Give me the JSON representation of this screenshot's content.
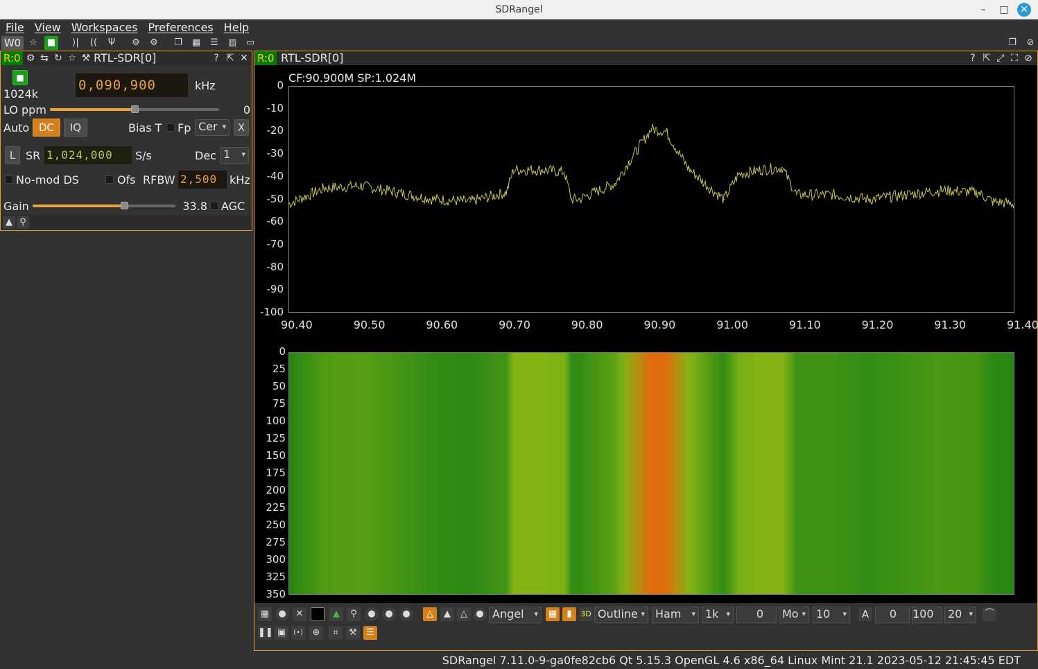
{
  "window": {
    "title": "SDRangel"
  },
  "menu": [
    "File",
    "View",
    "Workspaces",
    "Preferences",
    "Help"
  ],
  "workspace_label": "W0",
  "device_panel": {
    "rtag": "R:0",
    "title": "RTL-SDR[0]",
    "sample_rate_label": "1024k",
    "frequency": "0,090,900",
    "freq_unit": "kHz",
    "lo_ppm_label": "LO ppm",
    "lo_ppm_value": "0",
    "lo_ppm_fraction": 0.5,
    "auto_label": "Auto",
    "dc_label": "DC",
    "iq_label": "IQ",
    "bias_t_label": "Bias T",
    "fp_label": "Fp",
    "fp_combo": "Cer",
    "x_label": "X",
    "l_label": "L",
    "sr_label": "SR",
    "sr_value": "1,024,000",
    "sr_unit": "S/s",
    "dec_label": "Dec",
    "dec_value": "1",
    "nomod_label": "No-mod DS",
    "ofs_label": "Ofs",
    "rfbw_label": "RFBW",
    "rfbw_value": "2,500",
    "rfbw_unit": "kHz",
    "gain_label": "Gain",
    "gain_value": "33.8",
    "gain_fraction": 0.64,
    "agc_label": "AGC"
  },
  "spectrum_panel": {
    "rtag": "R:0",
    "title": "RTL-SDR[0]",
    "info": "CF:90.900M SP:1.024M",
    "y_ticks": [
      "0",
      "-10",
      "-20",
      "-30",
      "-40",
      "-50",
      "-60",
      "-70",
      "-80",
      "-90",
      "-100"
    ],
    "x_ticks": [
      "90.40",
      "90.50",
      "90.60",
      "90.70",
      "90.80",
      "90.90",
      "91.00",
      "91.10",
      "91.20",
      "91.30",
      "91.40"
    ],
    "wf_ticks": [
      "0",
      "25",
      "50",
      "75",
      "100",
      "125",
      "150",
      "175",
      "200",
      "225",
      "250",
      "275",
      "300",
      "325",
      "350"
    ],
    "trace_color": "#c8c85a",
    "bottom_controls": {
      "palette": "Angel",
      "fill": "Outline",
      "window": "Ham",
      "fft_size": "1k",
      "overlap": "0",
      "mode": "Mo",
      "rate": "10",
      "avg_label": "A",
      "ref": "0",
      "range": "100",
      "fps": "20"
    }
  },
  "chart_data": {
    "type": "line",
    "title": "CF:90.900M SP:1.024M",
    "xlim": [
      90.4,
      91.4
    ],
    "ylim": [
      -100,
      0
    ],
    "x": [
      90.4,
      90.45,
      90.5,
      90.55,
      90.6,
      90.65,
      90.7,
      90.71,
      90.75,
      90.78,
      90.79,
      90.8,
      90.85,
      90.87,
      90.9,
      90.92,
      90.95,
      90.98,
      91.0,
      91.02,
      91.05,
      91.08,
      91.1,
      91.15,
      91.2,
      91.25,
      91.3,
      91.35,
      91.37,
      91.4
    ],
    "y": [
      -52,
      -45,
      -44,
      -47,
      -50,
      -51,
      -47,
      -37,
      -37,
      -38,
      -50,
      -50,
      -43,
      -33,
      -19,
      -20,
      -36,
      -45,
      -50,
      -39,
      -37,
      -36,
      -48,
      -48,
      -50,
      -48,
      -46,
      -47,
      -51,
      -52
    ]
  },
  "status_text": "SDRangel 7.11.0-9-ga0fe82cb6 Qt 5.15.3 OpenGL 4.6 x86_64 Linux Mint 21.1 2023-05-12 21:45:45 EDT"
}
